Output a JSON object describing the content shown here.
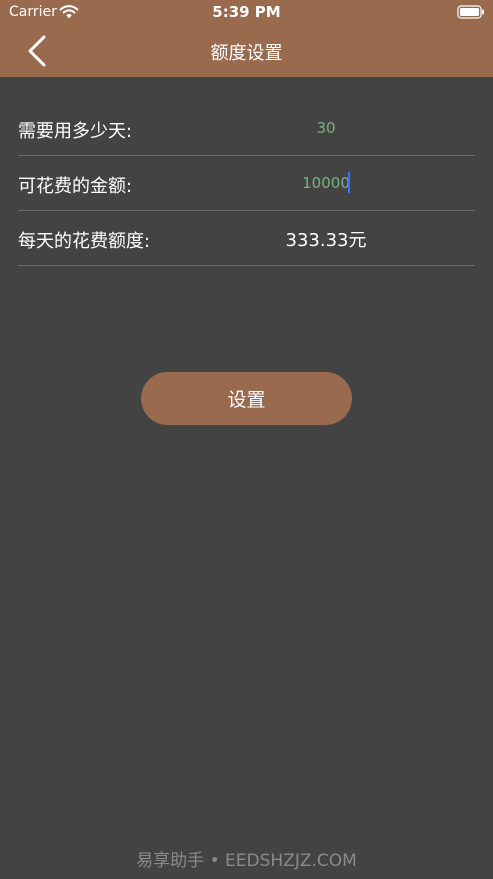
{
  "status_bar": {
    "carrier": "Carrier",
    "time": "5:39 PM"
  },
  "nav": {
    "title": "额度设置",
    "back_icon": "chevron-left-icon"
  },
  "form": {
    "days": {
      "label": "需要用多少天:",
      "value": "30"
    },
    "amount": {
      "label": "可花费的金额:",
      "value": "10000"
    },
    "daily": {
      "label": "每天的花费额度:",
      "value": "333.33元"
    }
  },
  "button": {
    "label": "设置"
  },
  "watermark": "易享助手 • EEDSHZJZ.COM",
  "colors": {
    "background": "#434343",
    "accent": "#9a6a4f",
    "input_text": "#78b27c",
    "caret": "#3b6cff",
    "divider": "#6b6b6b"
  }
}
